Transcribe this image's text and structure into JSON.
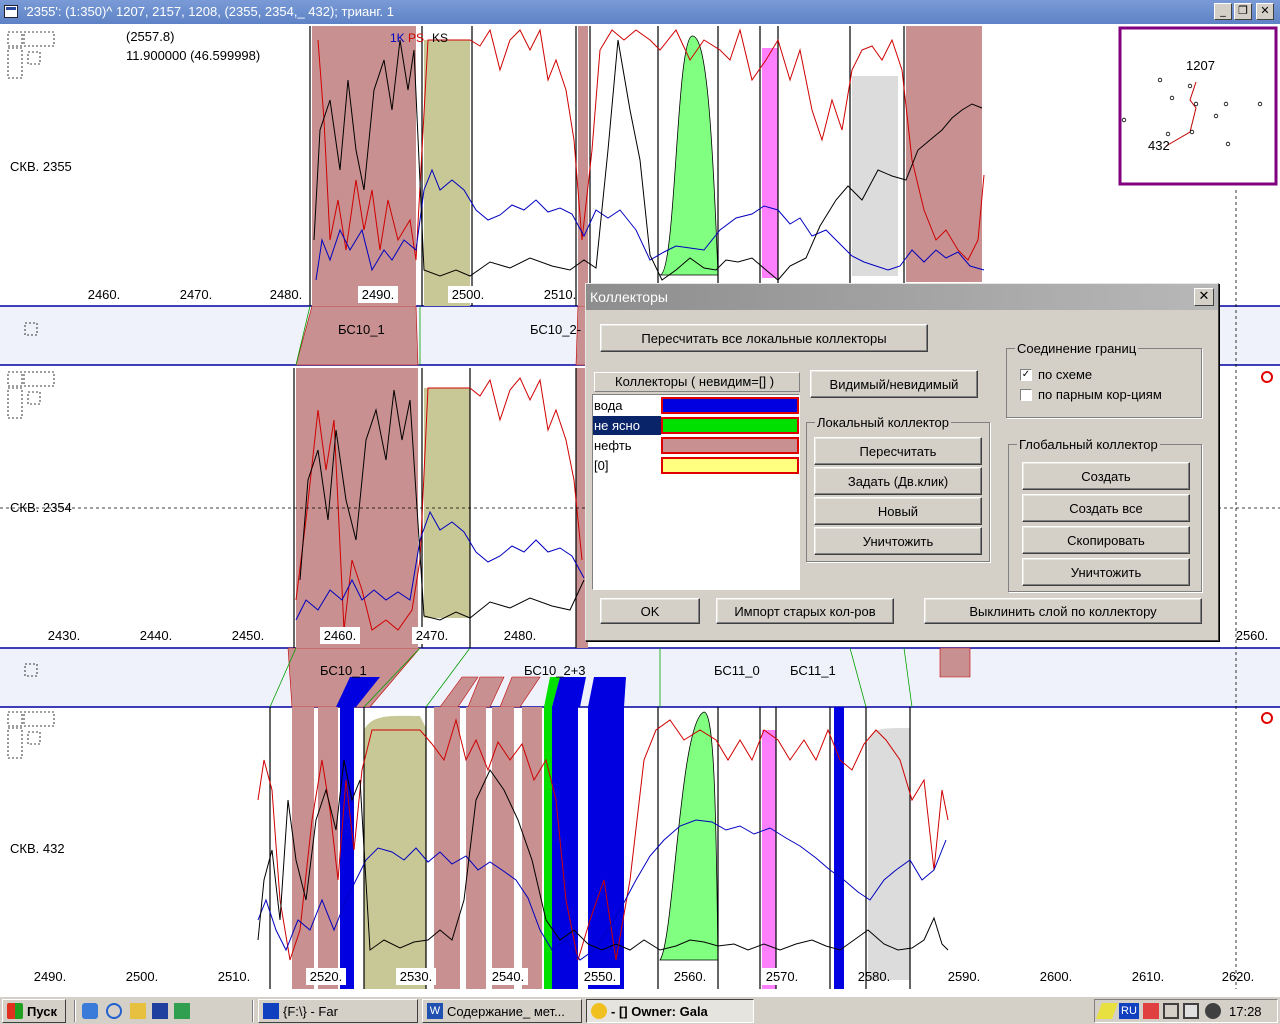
{
  "window": {
    "title": "'2355': (1:350)^ 1207, 2157, 1208, (2355, 2354,_ 432); трианг. 1",
    "minimize_glyph": "_",
    "restore_glyph": "❐",
    "close_glyph": "✕"
  },
  "wells": [
    {
      "name": "СКВ. 2355",
      "readout_depth": "(2557.8)",
      "readout_value": "11.900000 (46.599998)",
      "curve_legend": [
        "1K",
        "PS",
        "KS"
      ],
      "depth_ticks": [
        "2460.",
        "2470.",
        "2480.",
        "2490.",
        "2500.",
        "2510."
      ]
    },
    {
      "name": "СКВ. 2354",
      "depth_ticks": [
        "2430.",
        "2440.",
        "2450.",
        "2460.",
        "2470.",
        "2480.",
        "2560."
      ]
    },
    {
      "name": "СКВ. 432",
      "depth_ticks": [
        "2490.",
        "2500.",
        "2510.",
        "2520.",
        "2530.",
        "2540.",
        "2550.",
        "2560.",
        "2570.",
        "2580.",
        "2590.",
        "2600.",
        "2610.",
        "2620."
      ]
    }
  ],
  "correlation_labels": {
    "upper": [
      "БС10_1",
      "БС10_2-"
    ],
    "lower": [
      "БС10_1",
      "БС10_2+3",
      "БС11_0",
      "БС11_1"
    ]
  },
  "inset_map": {
    "labels": [
      "1207",
      "432"
    ]
  },
  "dialog": {
    "title": "Коллекторы",
    "close_glyph": "✕",
    "recalc_all_button": "Пересчитать все локальные коллекторы",
    "list_label": "Коллекторы ( невидим=[] )",
    "visible_toggle_button": "Видимый/невидимый",
    "collectors": [
      {
        "name": "вода",
        "color": "#0000e0",
        "selected": false
      },
      {
        "name": "не ясно",
        "color": "#00e000",
        "selected": true
      },
      {
        "name": "нефть",
        "color": "#c89090",
        "selected": false
      },
      {
        "name": "[0]",
        "color": "#ffff80",
        "selected": false
      }
    ],
    "local_group": {
      "label": "Локальный коллектор",
      "buttons": [
        "Пересчитать",
        "Задать (Дв.клик)",
        "Новый",
        "Уничтожить"
      ]
    },
    "boundary_group": {
      "label": "Соединение границ",
      "options": [
        {
          "label": "по схеме",
          "checked": true
        },
        {
          "label": "по парным кор-циям",
          "checked": false
        }
      ]
    },
    "global_group": {
      "label": "Глобальный коллектор",
      "buttons": [
        "Создать",
        "Создать все",
        "Скопировать",
        "Уничтожить"
      ]
    },
    "ok_button": "OK",
    "import_button": "Импорт старых кол-ров",
    "align_button": "Выклинить слой по коллектору"
  },
  "taskbar": {
    "start_label": "Пуск",
    "tasks": [
      {
        "label": "{F:\\} - Far",
        "pressed": false
      },
      {
        "label": "Содержание_ мет...",
        "pressed": false
      },
      {
        "label": "- [] Owner: Gala",
        "pressed": true
      }
    ],
    "lang": "RU",
    "clock": "17:28"
  },
  "colors": {
    "brown": "#c89090",
    "olive": "#c8c896",
    "green": "#80ff80",
    "blue": "#0000e0",
    "pink": "#ff80ff",
    "grey": "#dcdcdc",
    "band": "#f0f2fb",
    "band_border": "#0000a0",
    "inset_border": "#800080"
  },
  "chart_data": {
    "type": "line",
    "title": "",
    "series": [
      {
        "name": "1K"
      },
      {
        "name": "PS"
      },
      {
        "name": "KS"
      }
    ]
  }
}
